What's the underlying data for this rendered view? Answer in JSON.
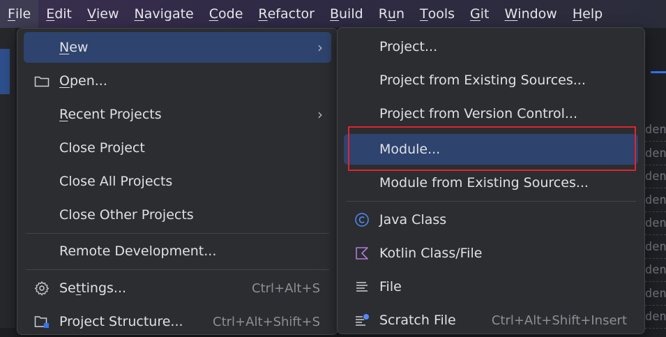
{
  "menubar": {
    "items": [
      {
        "label": "File",
        "mnemonic": "F",
        "rest": "ile",
        "active": true
      },
      {
        "label": "Edit",
        "mnemonic": "E",
        "rest": "dit"
      },
      {
        "label": "View",
        "mnemonic": "V",
        "rest": "iew"
      },
      {
        "label": "Navigate",
        "mnemonic": "N",
        "rest": "avigate"
      },
      {
        "label": "Code",
        "mnemonic": "C",
        "rest": "ode"
      },
      {
        "label": "Refactor",
        "mnemonic": "R",
        "rest": "efactor"
      },
      {
        "label": "Build",
        "mnemonic": "B",
        "rest": "uild"
      },
      {
        "label": "Run",
        "pre": "R",
        "mnemonic": "u",
        "rest": "n"
      },
      {
        "label": "Tools",
        "mnemonic": "T",
        "rest": "ools"
      },
      {
        "label": "Git",
        "mnemonic": "G",
        "rest": "it"
      },
      {
        "label": "Window",
        "mnemonic": "W",
        "rest": "indow"
      },
      {
        "label": "Help",
        "mnemonic": "H",
        "rest": "elp"
      }
    ]
  },
  "file_menu": {
    "new": {
      "mnemonic": "N",
      "rest": "ew",
      "submenu_glyph": "›"
    },
    "open": {
      "mnemonic": "O",
      "rest": "pen...",
      "icon": "folder-icon"
    },
    "recent_projects": {
      "mnemonic": "R",
      "rest": "ecent Projects",
      "submenu_glyph": "›"
    },
    "close_project": "Close Project",
    "close_all_projects": "Close All Projects",
    "close_other_projects": "Close Other Projects",
    "remote_development": "Remote Development...",
    "settings": {
      "pre": "Se",
      "mnemonic": "t",
      "rest": "tings...",
      "shortcut": "Ctrl+Alt+S",
      "icon": "gear-icon"
    },
    "project_structure": {
      "label": "Project Structure...",
      "shortcut": "Ctrl+Alt+Shift+S",
      "icon": "project-structure-icon"
    }
  },
  "new_menu": {
    "project": "Project...",
    "project_from_existing": "Project from Existing Sources...",
    "project_from_vcs": "Project from Version Control...",
    "module": "Module...",
    "module_from_existing": "Module from Existing Sources...",
    "java_class": {
      "label": "Java Class",
      "icon": "java-class-icon"
    },
    "kotlin_class": {
      "label": "Kotlin Class/File",
      "icon": "kotlin-icon"
    },
    "file": {
      "label": "File",
      "icon": "file-lines-icon"
    },
    "scratch_file": {
      "label": "Scratch File",
      "shortcut": "Ctrl+Alt+Shift+Insert",
      "icon": "scratch-file-icon"
    }
  },
  "background_code": {
    "fragment": "den"
  },
  "colors": {
    "menu_bg": "#2b2d30",
    "selection": "#2e436e",
    "highlight_border": "#e0242f",
    "accent": "#3574f0"
  }
}
